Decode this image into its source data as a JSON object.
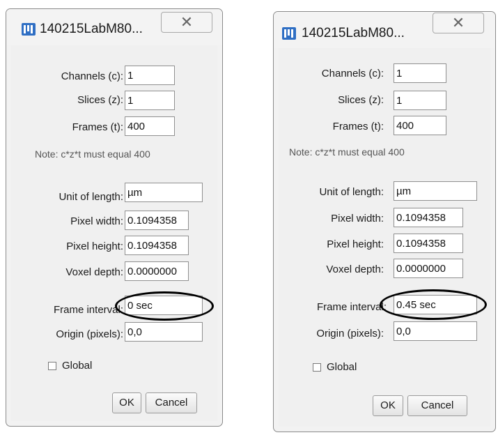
{
  "dialogs": [
    {
      "title": "140215LabM80...",
      "close_glyph": "✕",
      "fields": {
        "channels": {
          "label": "Channels (c):",
          "value": "1"
        },
        "slices": {
          "label": "Slices (z):",
          "value": "1"
        },
        "frames": {
          "label": "Frames (t):",
          "value": "400"
        },
        "unit": {
          "label": "Unit of length:",
          "value": "µm"
        },
        "pixel_width": {
          "label": "Pixel width:",
          "value": "0.1094358"
        },
        "pixel_height": {
          "label": "Pixel height:",
          "value": "0.1094358"
        },
        "voxel_depth": {
          "label": "Voxel depth:",
          "value": "0.0000000"
        },
        "frame_interval": {
          "label": "Frame interval:",
          "value": "0 sec"
        },
        "origin": {
          "label": "Origin (pixels):",
          "value": "0,0"
        }
      },
      "note": "Note: c*z*t must equal 400",
      "global_label": "Global",
      "global_checked": false,
      "ok_label": "OK",
      "cancel_label": "Cancel"
    },
    {
      "title": "140215LabM80...",
      "close_glyph": "✕",
      "fields": {
        "channels": {
          "label": "Channels (c):",
          "value": "1"
        },
        "slices": {
          "label": "Slices (z):",
          "value": "1"
        },
        "frames": {
          "label": "Frames (t):",
          "value": "400"
        },
        "unit": {
          "label": "Unit of length:",
          "value": "µm"
        },
        "pixel_width": {
          "label": "Pixel width:",
          "value": "0.1094358"
        },
        "pixel_height": {
          "label": "Pixel height:",
          "value": "0.1094358"
        },
        "voxel_depth": {
          "label": "Voxel depth:",
          "value": "0.0000000"
        },
        "frame_interval": {
          "label": "Frame interval:",
          "value": "0.45 sec"
        },
        "origin": {
          "label": "Origin (pixels):",
          "value": "0,0"
        }
      },
      "note": "Note: c*z*t must equal 400",
      "global_label": "Global",
      "global_checked": false,
      "ok_label": "OK",
      "cancel_label": "Cancel"
    }
  ],
  "colors": {
    "dialog_bg": "#f0f0f0",
    "icon_blue": "#2f6fc4",
    "highlight_ellipse": "#000000"
  }
}
